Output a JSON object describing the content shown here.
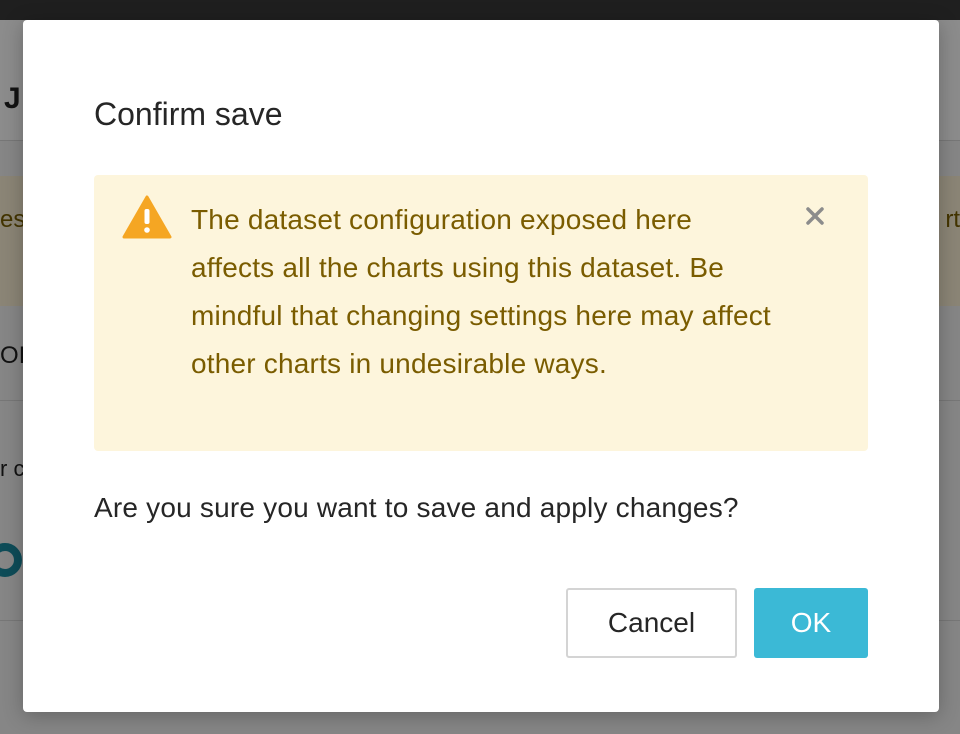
{
  "background": {
    "header_title": "J",
    "alert_left_fragment": "es",
    "alert_right_fragment": "rt",
    "tab_fragment": "OI",
    "small_text_fragment": "r c"
  },
  "modal": {
    "title": "Confirm save",
    "warning": {
      "icon": "warning-icon",
      "message": "The dataset configuration exposed here affects all the charts using this dataset. Be mindful that changing settings here may affect other charts in undesirable ways.",
      "close_icon": "close-icon"
    },
    "question": "Are you sure you want to save and apply changes?",
    "buttons": {
      "cancel_label": "Cancel",
      "ok_label": "OK"
    }
  },
  "colors": {
    "primary": "#3bb9d6",
    "warning_bg": "#fdf5dc",
    "warning_text": "#7a5c00",
    "warning_icon": "#f5a623"
  }
}
